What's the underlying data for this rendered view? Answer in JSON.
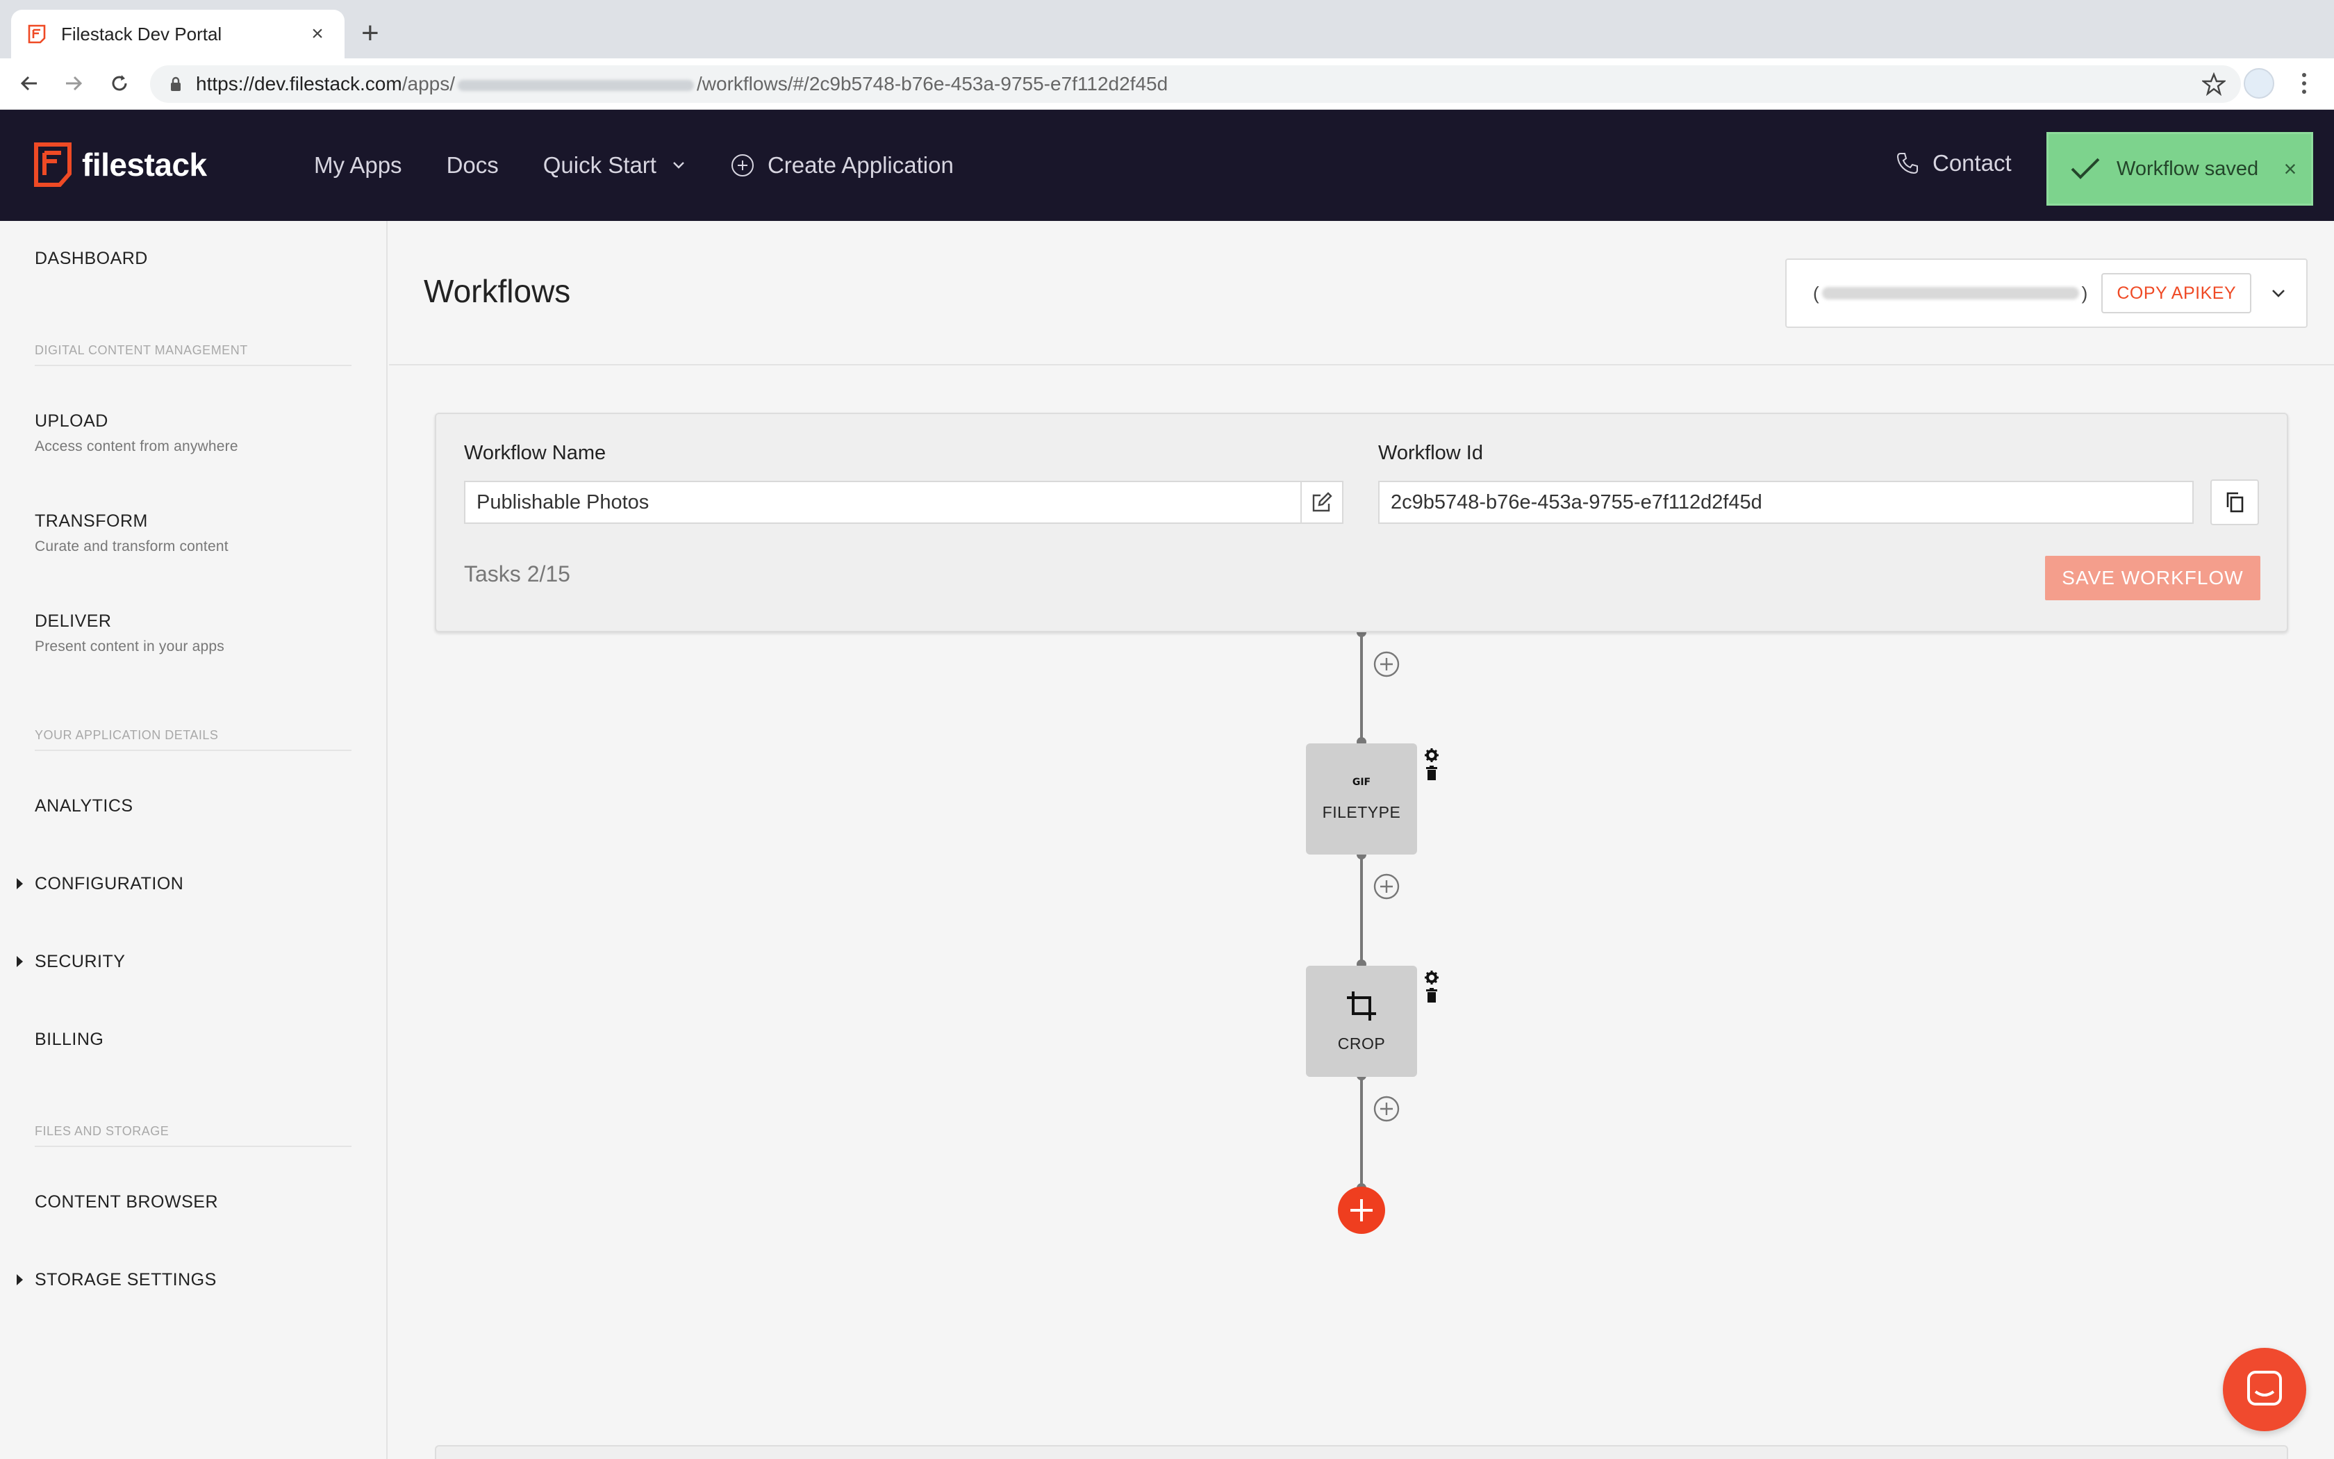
{
  "browser": {
    "tab_title": "Filestack Dev Portal",
    "url_prefix": "https://dev.filestack.com",
    "url_mid": "/apps/",
    "url_suffix": "/workflows/#/2c9b5748-b76e-453a-9755-e7f112d2f45d"
  },
  "header": {
    "logo": "filestack",
    "nav": [
      "My Apps",
      "Docs",
      "Quick Start",
      "Create Application"
    ],
    "contact": "Contact",
    "brand_color": "#ef4a25"
  },
  "toast": {
    "message": "Workflow saved",
    "color": "#7dd38d"
  },
  "sidebar": {
    "dashboard": "DASHBOARD",
    "section_dcm": "DIGITAL CONTENT MANAGEMENT",
    "upload": {
      "label": "UPLOAD",
      "sub": "Access content from anywhere"
    },
    "transform": {
      "label": "TRANSFORM",
      "sub": "Curate and transform content"
    },
    "deliver": {
      "label": "DELIVER",
      "sub": "Present content in your apps"
    },
    "section_app": "YOUR APPLICATION DETAILS",
    "analytics": "ANALYTICS",
    "configuration": "CONFIGURATION",
    "security": "SECURITY",
    "billing": "BILLING",
    "section_files": "FILES AND STORAGE",
    "content_browser": "CONTENT BROWSER",
    "storage_settings": "STORAGE SETTINGS"
  },
  "page": {
    "title": "Workflows",
    "copy_apikey": "COPY APIKEY",
    "apikey_open": "(",
    "apikey_close": ")"
  },
  "workflow": {
    "name_label": "Workflow Name",
    "name_value": "Publishable Photos",
    "id_label": "Workflow Id",
    "id_value": "2c9b5748-b76e-453a-9755-e7f112d2f45d",
    "tasks": "Tasks 2/15",
    "save_button": "SAVE WORKFLOW",
    "nodes": [
      {
        "label": "FILETYPE",
        "icon": "gif-icon",
        "badge": "GIF"
      },
      {
        "label": "CROP",
        "icon": "crop-icon"
      }
    ]
  }
}
